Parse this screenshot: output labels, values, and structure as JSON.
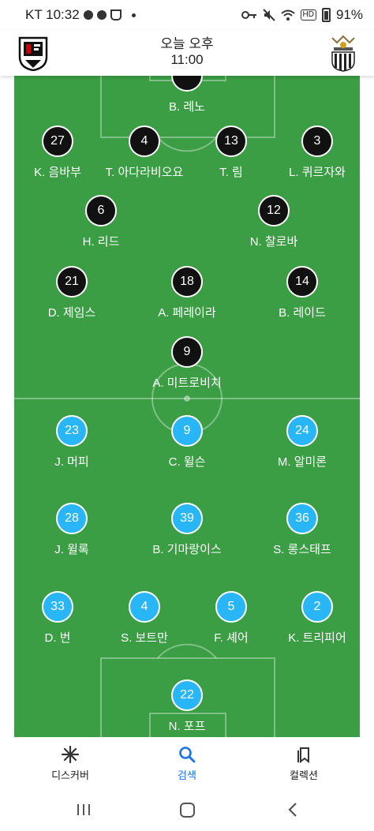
{
  "status_bar": {
    "carrier_time": "KT 10:32",
    "battery": "91%",
    "icons": [
      "facebook-icon",
      "soccer-ball-icon",
      "trophy-icon",
      "dot-icon",
      "key-icon",
      "mute-icon",
      "wifi-icon",
      "hd-icon",
      "battery-icon"
    ]
  },
  "header": {
    "time_line1": "오늘 오후",
    "time_line2": "11:00",
    "home_crest": "fulham-crest",
    "away_crest": "newcastle-crest"
  },
  "home_players": [
    {
      "number": "",
      "name": "B. 레노"
    },
    {
      "number": "27",
      "name": "K. 음바부"
    },
    {
      "number": "4",
      "name": "T. 아다라비오요"
    },
    {
      "number": "13",
      "name": "T. 림"
    },
    {
      "number": "3",
      "name": "L. 퀴르자와"
    },
    {
      "number": "6",
      "name": "H. 리드"
    },
    {
      "number": "12",
      "name": "N. 찰로바"
    },
    {
      "number": "21",
      "name": "D. 제임스"
    },
    {
      "number": "18",
      "name": "A. 페레이라"
    },
    {
      "number": "14",
      "name": "B. 레이드"
    },
    {
      "number": "9",
      "name": "A. 미트로비치"
    }
  ],
  "away_players": [
    {
      "number": "23",
      "name": "J. 머피"
    },
    {
      "number": "9",
      "name": "C. 윌슨"
    },
    {
      "number": "24",
      "name": "M. 알미론"
    },
    {
      "number": "28",
      "name": "J. 윌록"
    },
    {
      "number": "39",
      "name": "B. 기마랑이스"
    },
    {
      "number": "36",
      "name": "S. 롱스태프"
    },
    {
      "number": "33",
      "name": "D. 번"
    },
    {
      "number": "4",
      "name": "S. 보트만"
    },
    {
      "number": "5",
      "name": "F. 셰어"
    },
    {
      "number": "2",
      "name": "K. 트리피어"
    },
    {
      "number": "22",
      "name": "N. 포프"
    }
  ],
  "bottom_nav": {
    "discover": "디스커버",
    "search": "검색",
    "collections": "컬렉션",
    "active": "search",
    "accent": "#1a73e8"
  },
  "colors": {
    "pitch": "#3b9e44",
    "home_circle": "#111111",
    "away_circle": "#29b6f6"
  }
}
